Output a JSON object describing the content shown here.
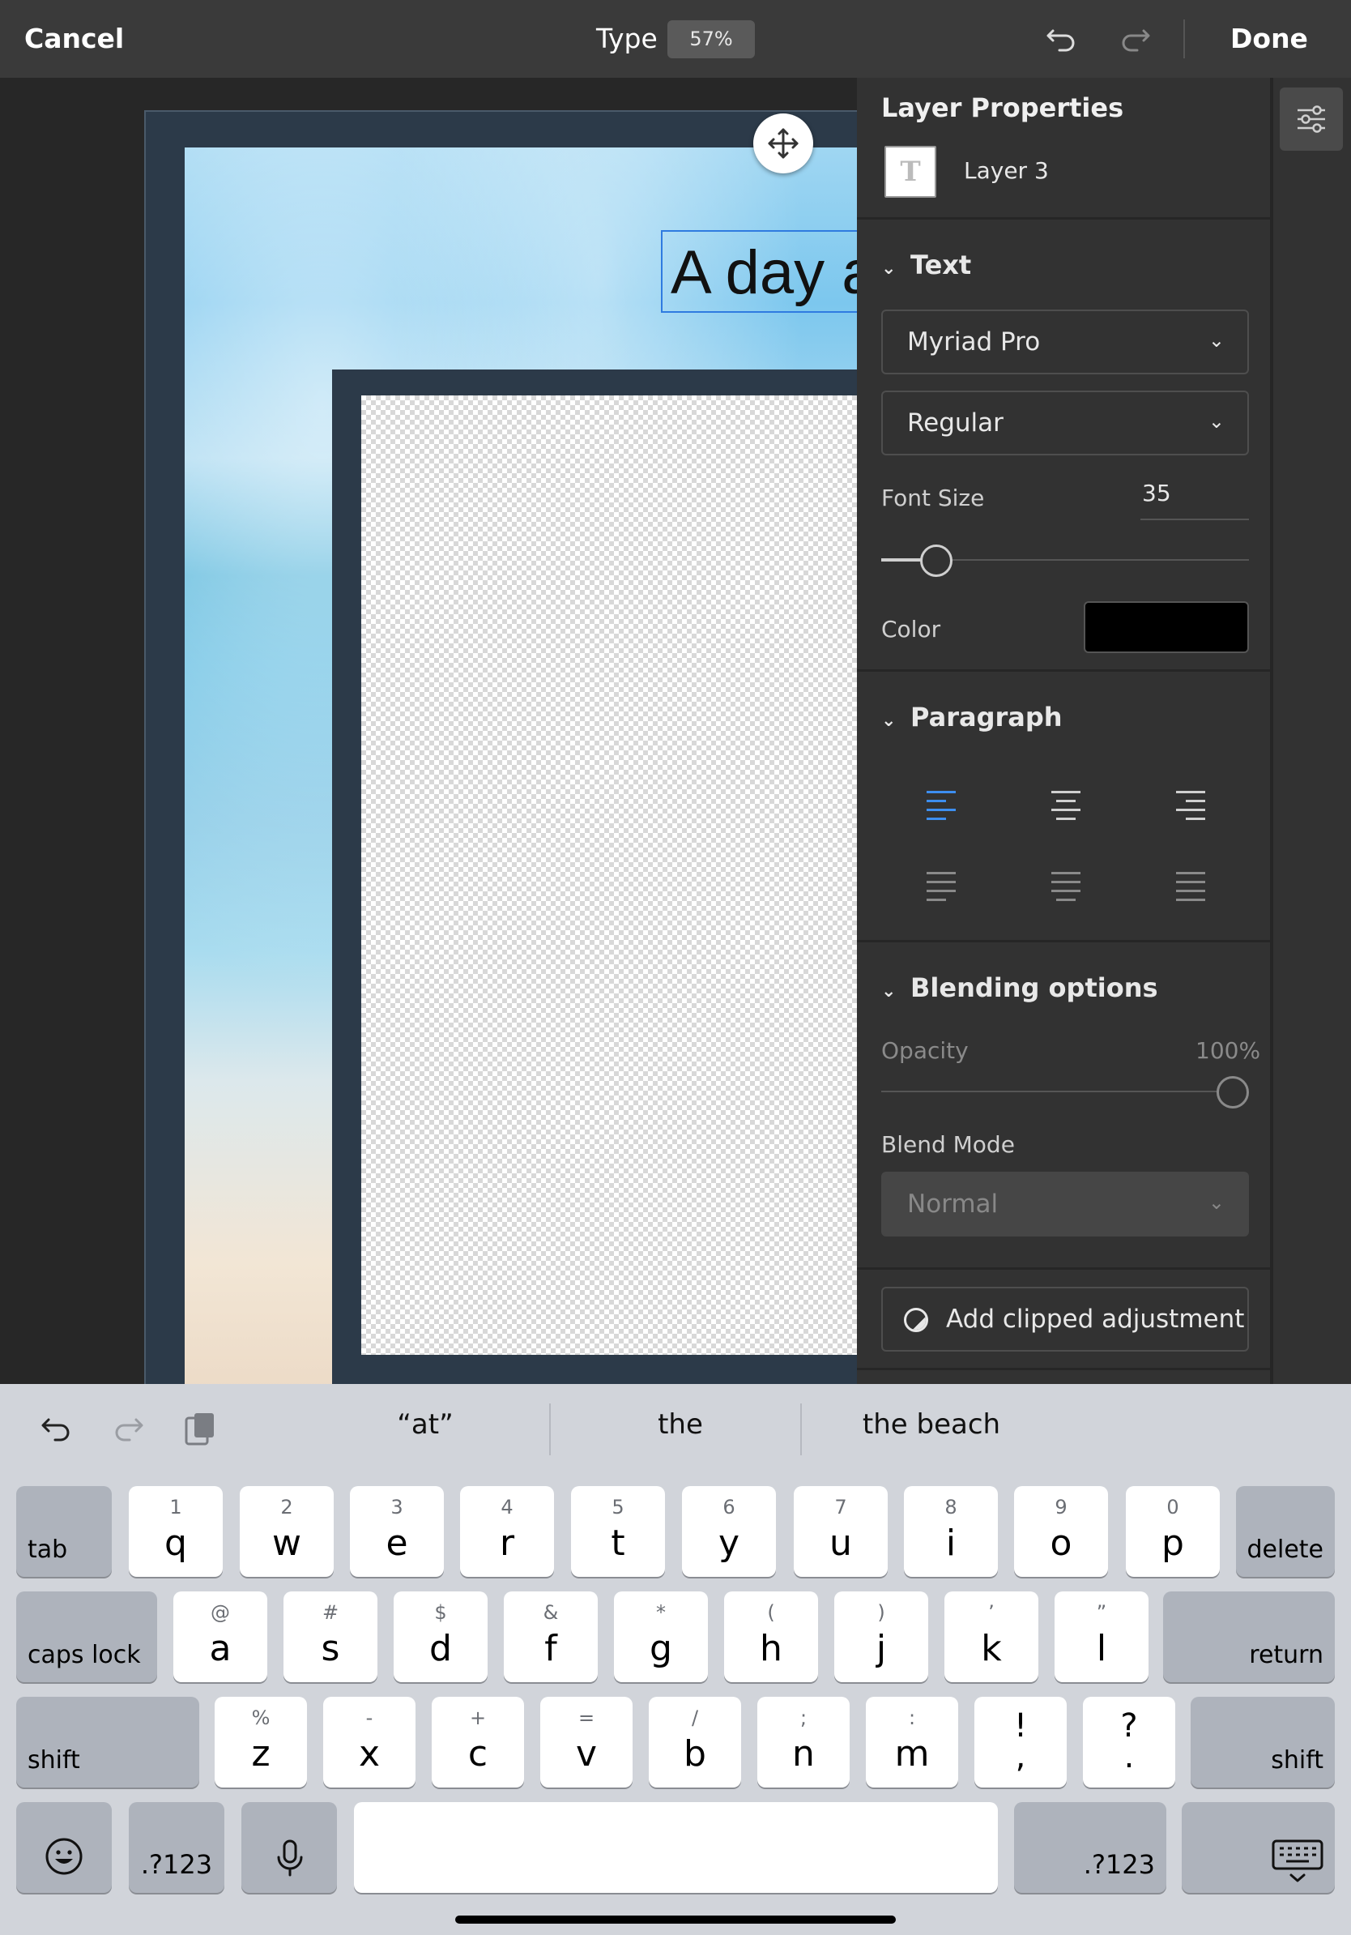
{
  "topbar": {
    "cancel": "Cancel",
    "tool_label": "Type",
    "zoom": "57%",
    "done": "Done",
    "undo_icon": "undo-icon",
    "redo_icon": "redo-icon"
  },
  "canvas": {
    "text_layer_content": "A day a",
    "move_icon": "move-icon"
  },
  "panel": {
    "title": "Layer Properties",
    "layer_name": "Layer 3",
    "layer_thumb_glyph": "T",
    "text_section": {
      "heading": "Text",
      "font_family": "Myriad Pro",
      "font_style": "Regular",
      "font_size_label": "Font Size",
      "font_size_value": "35",
      "font_size_slider_fraction": 0.08,
      "color_label": "Color",
      "color_value": "#000000"
    },
    "paragraph_section": {
      "heading": "Paragraph",
      "active_alignment": "left"
    },
    "blending_section": {
      "heading": "Blending options",
      "opacity_label": "Opacity",
      "opacity_value": "100%",
      "opacity_fraction": 1.0,
      "blend_mode_label": "Blend Mode",
      "blend_mode_value": "Normal"
    },
    "add_clipped": "Add clipped adjustment"
  },
  "keyboard": {
    "suggestions": [
      "“at”",
      "the",
      "the beach"
    ],
    "row1": [
      {
        "sec": "1",
        "main": "q"
      },
      {
        "sec": "2",
        "main": "w"
      },
      {
        "sec": "3",
        "main": "e"
      },
      {
        "sec": "4",
        "main": "r"
      },
      {
        "sec": "5",
        "main": "t"
      },
      {
        "sec": "6",
        "main": "y"
      },
      {
        "sec": "7",
        "main": "u"
      },
      {
        "sec": "8",
        "main": "i"
      },
      {
        "sec": "9",
        "main": "o"
      },
      {
        "sec": "0",
        "main": "p"
      }
    ],
    "row2": [
      {
        "sec": "@",
        "main": "a"
      },
      {
        "sec": "#",
        "main": "s"
      },
      {
        "sec": "$",
        "main": "d"
      },
      {
        "sec": "&",
        "main": "f"
      },
      {
        "sec": "*",
        "main": "g"
      },
      {
        "sec": "(",
        "main": "h"
      },
      {
        "sec": ")",
        "main": "j"
      },
      {
        "sec": "’",
        "main": "k"
      },
      {
        "sec": "”",
        "main": "l"
      }
    ],
    "row3": [
      {
        "sec": "%",
        "main": "z"
      },
      {
        "sec": "-",
        "main": "x"
      },
      {
        "sec": "+",
        "main": "c"
      },
      {
        "sec": "=",
        "main": "v"
      },
      {
        "sec": "/",
        "main": "b"
      },
      {
        "sec": ";",
        "main": "n"
      },
      {
        "sec": ":",
        "main": "m"
      },
      {
        "sec": "!",
        "main": ","
      },
      {
        "sec": "?",
        "main": "."
      }
    ],
    "tab": "tab",
    "delete": "delete",
    "caps_lock": "caps lock",
    "return": "return",
    "shift": "shift",
    "numbers": ".?123"
  }
}
